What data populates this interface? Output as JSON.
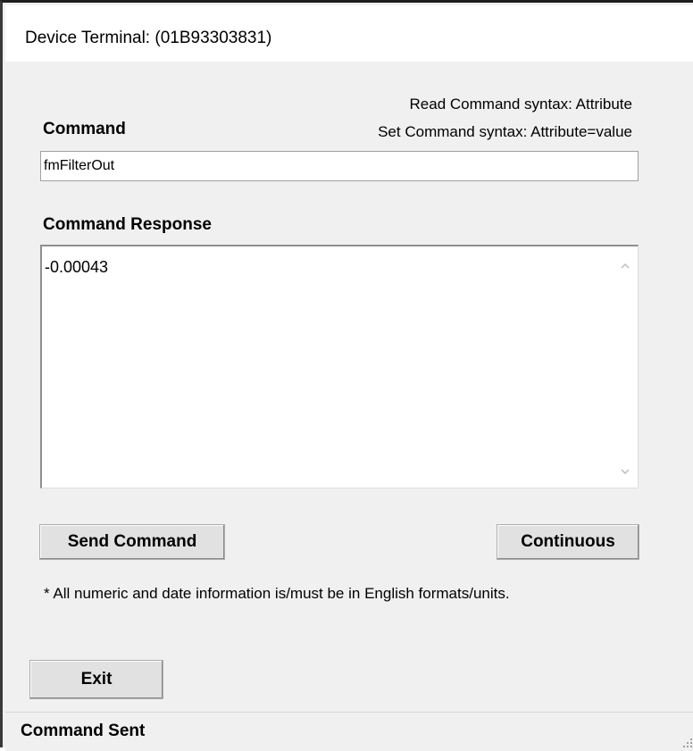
{
  "window": {
    "title": "Device Terminal: (01B93303831)"
  },
  "syntax": {
    "read": "Read Command syntax: Attribute",
    "set": "Set Command syntax: Attribute=value"
  },
  "command": {
    "label": "Command",
    "value": "fmFilterOut"
  },
  "response": {
    "label": "Command Response",
    "text": "-0.00043"
  },
  "buttons": {
    "send": "Send Command",
    "continuous": "Continuous",
    "exit": "Exit"
  },
  "note": "* All numeric and date information is/must be in English formats/units.",
  "status": {
    "text": "Command Sent"
  },
  "icons": {
    "scroll_up": "chevron-up-icon",
    "scroll_down": "chevron-down-icon",
    "resize_grip": "resize-grip-icon"
  }
}
